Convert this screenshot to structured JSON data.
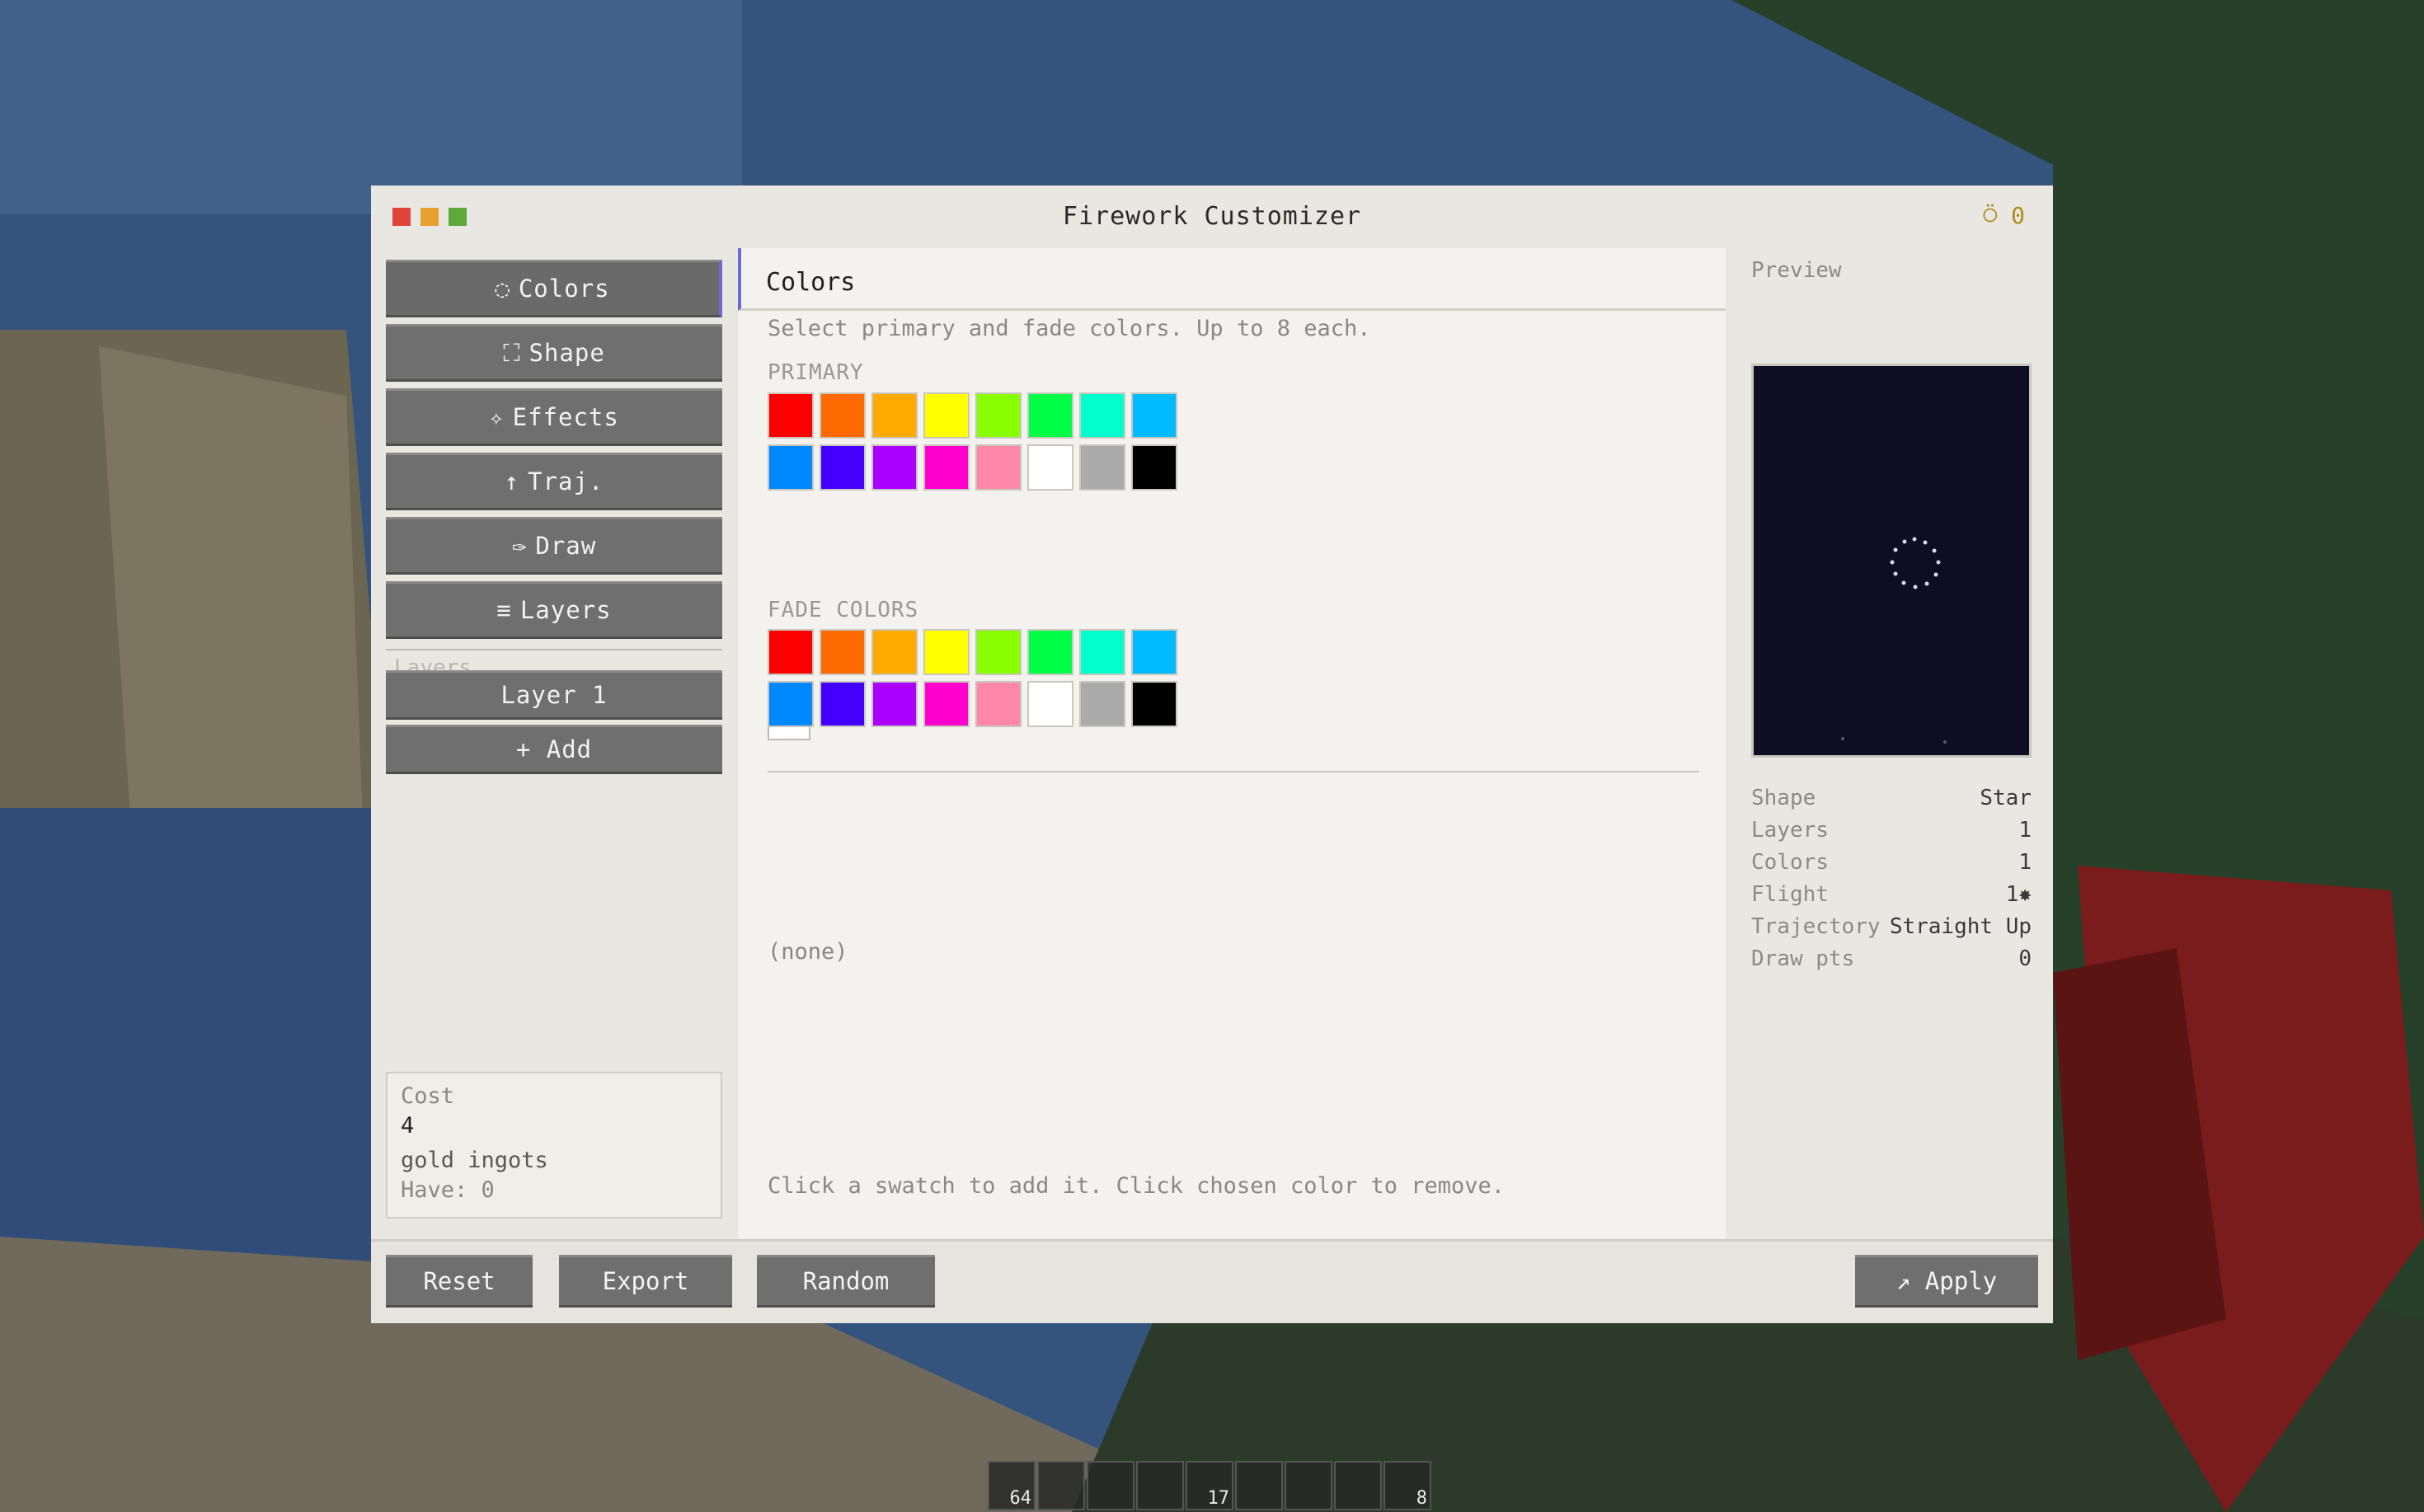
{
  "window": {
    "title": "Firework Customizer",
    "gold_count": "0",
    "traffic_colors": [
      "#e0453b",
      "#e8a030",
      "#5fa83a"
    ]
  },
  "sidebar": {
    "items": [
      {
        "icon": "◌",
        "label": "Colors"
      },
      {
        "icon": "⛶",
        "label": "Shape"
      },
      {
        "icon": "✧",
        "label": "Effects"
      },
      {
        "icon": "↑",
        "label": "Traj."
      },
      {
        "icon": "✑",
        "label": "Draw"
      },
      {
        "icon": "≡",
        "label": "Layers"
      }
    ],
    "layers_caption": "Layers",
    "layer_item": "Layer 1",
    "add_label": "+ Add",
    "cost": {
      "label": "Cost",
      "amount": "4",
      "unit": "gold ingots",
      "have": "Have: 0"
    }
  },
  "colors_panel": {
    "heading": "Colors",
    "hint": "Select primary and fade colors. Up to 8 each.",
    "primary_label": "PRIMARY",
    "fade_label": "FADE COLORS",
    "fade_none": "(none)",
    "footer_hint": "Click a swatch to add it. Click chosen color to remove.",
    "palette": [
      "#ff0000",
      "#ff6a00",
      "#ffaa00",
      "#ffff00",
      "#88ff00",
      "#00ff44",
      "#00ffcc",
      "#00bbff",
      "#0088ff",
      "#4400ff",
      "#aa00ff",
      "#ff00cc",
      "#ff88aa",
      "#ffffff",
      "#aaaaaa",
      "#000000"
    ],
    "selected_primary": [
      "#ffffff"
    ]
  },
  "preview": {
    "label": "Preview",
    "stats": [
      {
        "key": "Shape",
        "value": "Star"
      },
      {
        "key": "Layers",
        "value": "1"
      },
      {
        "key": "Colors",
        "value": "1"
      },
      {
        "key": "Flight",
        "value": "1✸"
      },
      {
        "key": "Trajectory",
        "value": "Straight Up"
      },
      {
        "key": "Draw pts",
        "value": "0"
      }
    ]
  },
  "bottom_bar": {
    "reset": "Reset",
    "export": "Export",
    "random": "Random",
    "apply": "↗ Apply"
  },
  "hotbar": {
    "slots": [
      "64",
      "",
      "",
      "",
      "17",
      "",
      "",
      "",
      "8"
    ]
  }
}
